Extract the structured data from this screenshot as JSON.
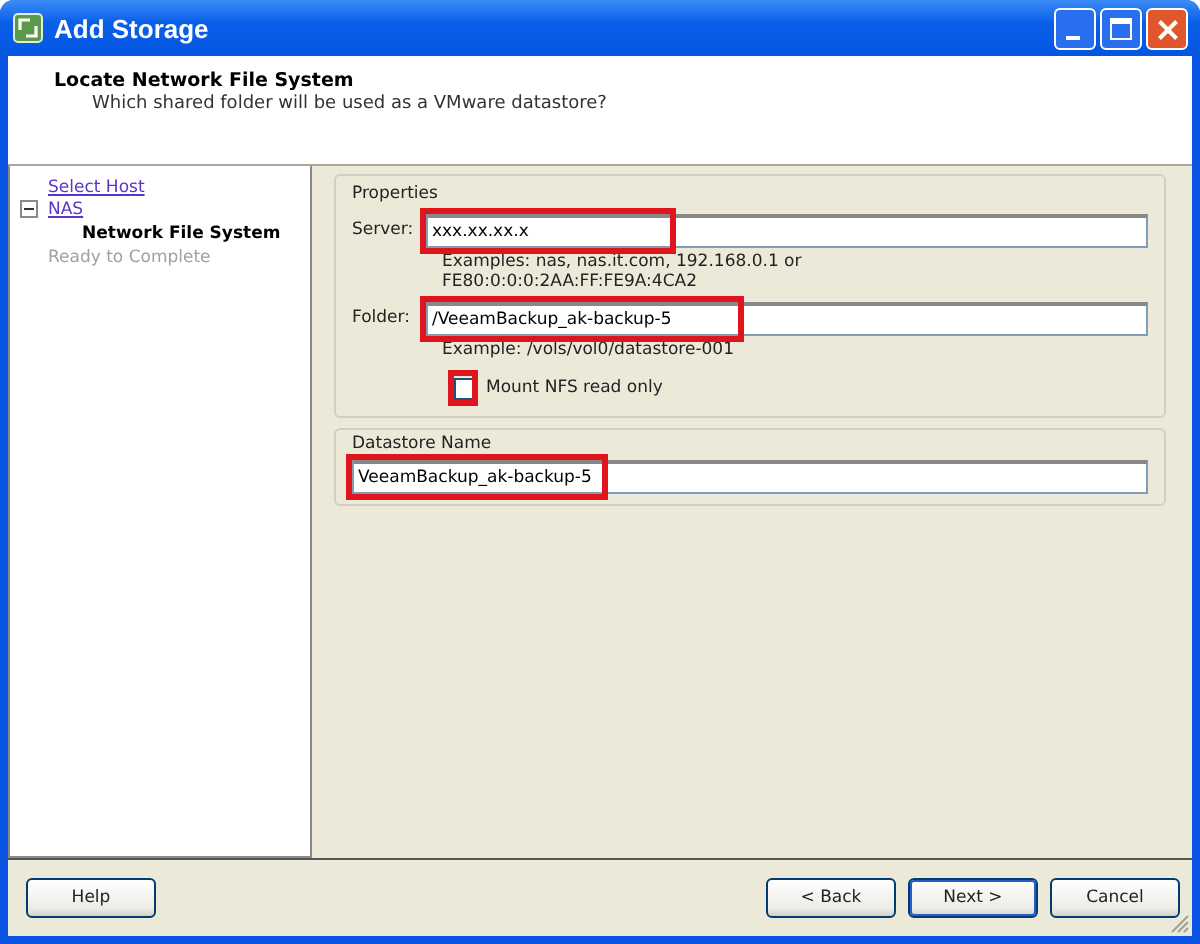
{
  "window": {
    "title": "Add Storage"
  },
  "header": {
    "title": "Locate Network File System",
    "subtitle": "Which shared folder will be used as a VMware datastore?"
  },
  "nav": [
    {
      "label": "Select Host",
      "kind": "link"
    },
    {
      "label": "NAS",
      "kind": "link",
      "expanded": true,
      "children": [
        {
          "label": "Network File System",
          "kind": "current"
        }
      ]
    },
    {
      "label": "Ready to Complete",
      "kind": "disabled"
    }
  ],
  "properties": {
    "title": "Properties",
    "server": {
      "label": "Server:",
      "value": "xxx.xx.xx.x",
      "highlighted": true,
      "hint": "Examples: nas, nas.it.com, 192.168.0.1 or\nFE80:0:0:0:2AA:FF:FE9A:4CA2"
    },
    "folder": {
      "label": "Folder:",
      "value": "/VeeamBackup_ak-backup-5",
      "highlighted": true,
      "hint": "Example: /vols/vol0/datastore-001"
    },
    "read_only": {
      "label": "Mount NFS read only",
      "checked": false,
      "highlighted": true
    }
  },
  "datastore": {
    "title": "Datastore Name",
    "value": "VeeamBackup_ak-backup-5",
    "highlighted": true
  },
  "buttons": [
    {
      "label": "Help",
      "kind": "left"
    },
    {
      "label": "< Back",
      "kind": "right"
    },
    {
      "label": "Next >",
      "kind": "default"
    },
    {
      "label": "Cancel",
      "kind": "right"
    }
  ]
}
